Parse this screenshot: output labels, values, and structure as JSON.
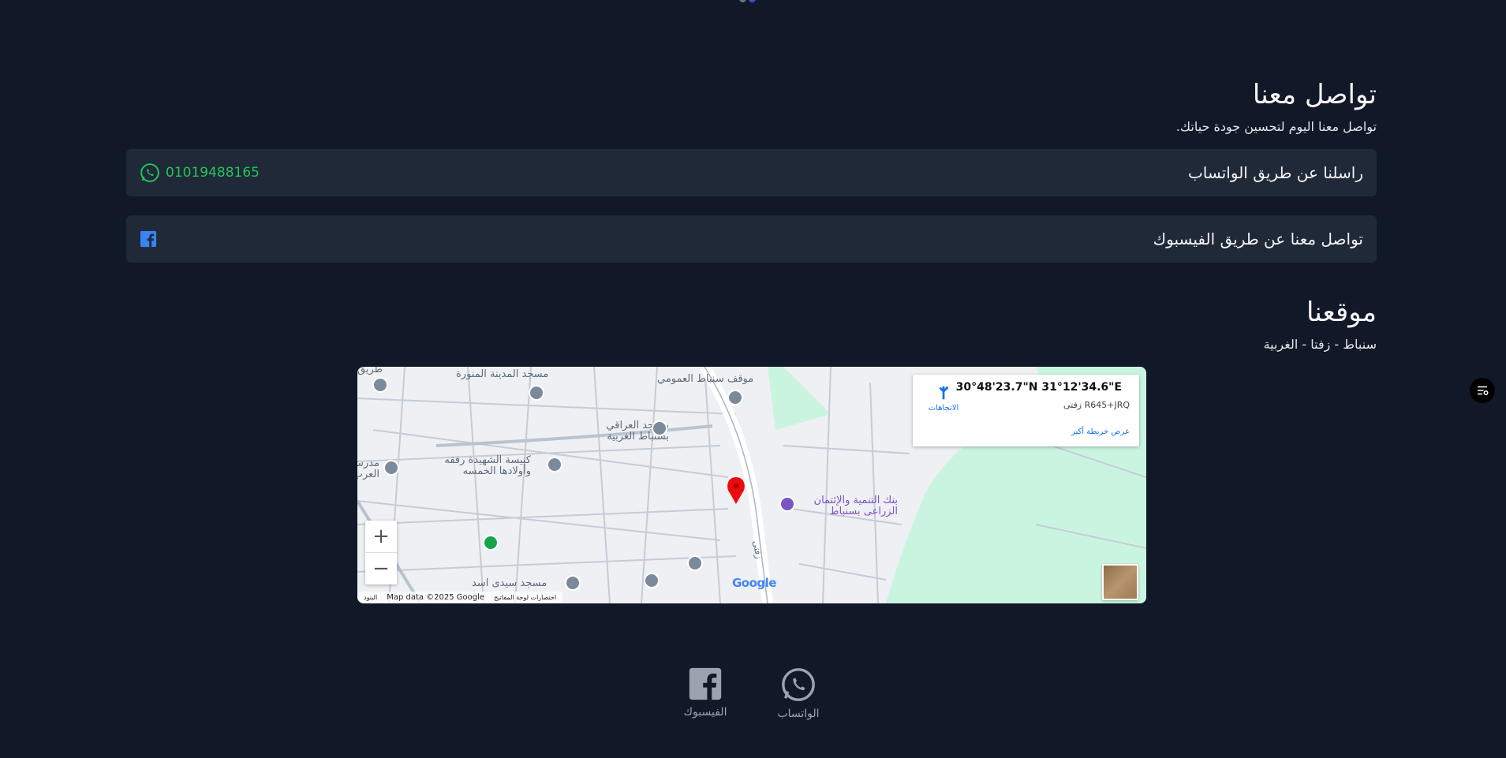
{
  "contact": {
    "title": "تواصل معنا",
    "subtitle": "تواصل معنا اليوم لتحسين جودة حياتك.",
    "whatsapp": {
      "label": "راسلنا عن طريق الواتساب",
      "phone": "01019488165"
    },
    "facebook": {
      "label": "تواصل معنا عن طريق الفيسبوك"
    }
  },
  "location": {
    "title": "موقعنا",
    "address": "سنباط - زفتا - الغربية"
  },
  "map": {
    "coords": "30°48'23.7\"N 31°12'34.6\"E",
    "plus_code": "R645+JRQ زفتى",
    "larger_map": "عرض خريطة أكبر",
    "directions": "الاتجاهات",
    "zoom_in": "+",
    "zoom_out": "−",
    "attribution": "Map data ©2025 Google",
    "shortcuts": "اختصارات لوحة المفاتيح",
    "terms": "البنود",
    "google": "Google",
    "road_label": "زفتى",
    "pois": [
      "مسجد المدينة المنورة",
      "موقف سنباط العمومي",
      "مسجد العراقي بسنباط الغربية",
      "كنيسة الشهيدة رفقه وأولادها الخمسه",
      "بنك التنمية والإئتمان الزراعى بسنباط",
      "مسجد سيدى اسد",
      "طريق",
      "مدرسة العرب"
    ]
  },
  "footer": {
    "whatsapp_label": "الواتساب",
    "facebook_label": "الفيسبوك"
  },
  "colors": {
    "background": "#111827",
    "card": "#1f2937",
    "whatsapp_green": "#22c55e",
    "facebook_blue": "#3b82f6",
    "pin_red": "#ea0c0c"
  },
  "icons": [
    "whatsapp-icon",
    "facebook-icon",
    "directions-icon",
    "map-marker-icon",
    "menu-toggle-icon"
  ]
}
